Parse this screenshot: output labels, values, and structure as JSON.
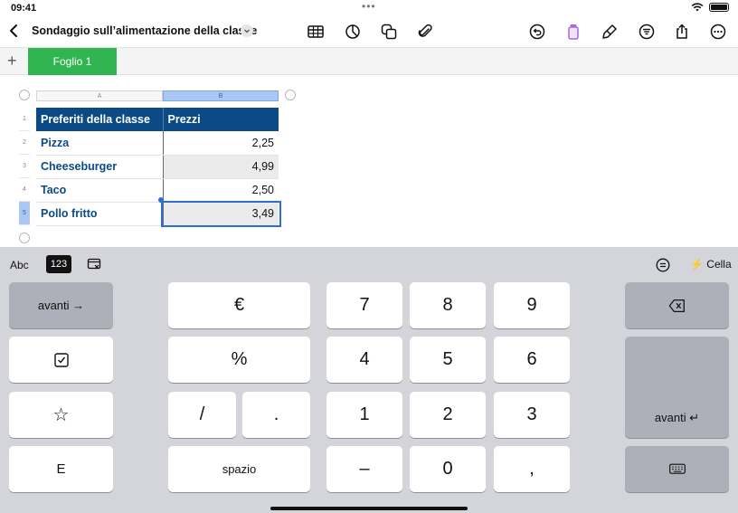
{
  "status": {
    "time": "09:41",
    "dots": "•••"
  },
  "toolbar": {
    "title": "Sondaggio sull’alimentazione della classe"
  },
  "tabs": {
    "add": "+",
    "sheet": "Foglio 1"
  },
  "sheet": {
    "columns": [
      "A",
      "B"
    ],
    "rows": [
      "1",
      "2",
      "3",
      "4",
      "5"
    ],
    "header": {
      "a": "Preferiti della classe",
      "b": "Prezzi"
    },
    "data": [
      {
        "item": "Pizza",
        "price": "2,25"
      },
      {
        "item": "Cheeseburger",
        "price": "4,99"
      },
      {
        "item": "Taco",
        "price": "2,50"
      },
      {
        "item": "Pollo fritto",
        "price": "3,49"
      }
    ]
  },
  "keyboard": {
    "abc": "Abc",
    "num": "123",
    "cell": "Cella",
    "next_right": "avanti →",
    "next_enter": "avanti ↵",
    "space": "spazio",
    "keys": {
      "euro": "€",
      "percent": "%",
      "slash": "/",
      "dot": ".",
      "seven": "7",
      "eight": "8",
      "nine": "9",
      "four": "4",
      "five": "5",
      "six": "6",
      "one": "1",
      "two": "2",
      "three": "3",
      "minus": "–",
      "zero": "0",
      "comma": ",",
      "star": "☆",
      "e": "E"
    }
  },
  "colors": {
    "accent_green": "#30b550",
    "header_blue": "#0b4a85",
    "selection_blue": "#2d6fd0"
  }
}
